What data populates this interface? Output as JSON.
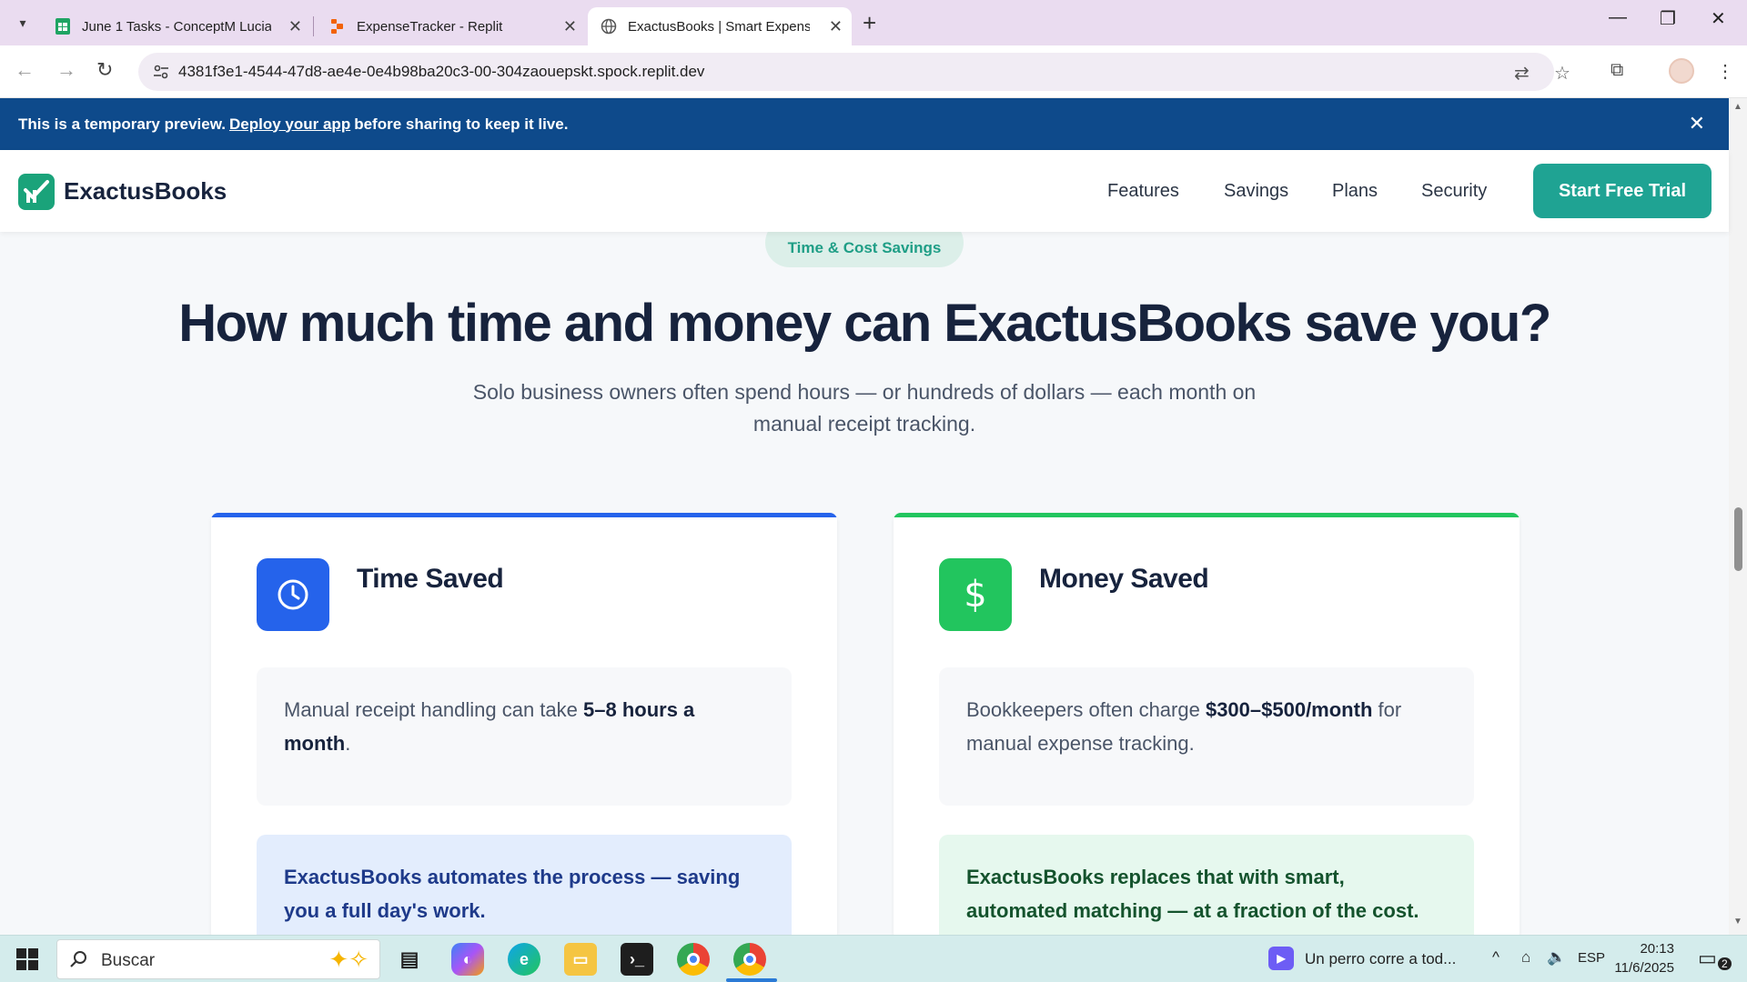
{
  "browser": {
    "tabs": [
      {
        "title": "June 1 Tasks - ConceptM Lucia",
        "favicon": "sheets-icon"
      },
      {
        "title": "ExpenseTracker - Replit",
        "favicon": "replit-icon"
      },
      {
        "title": "ExactusBooks | Smart Expense T",
        "favicon": "globe-icon",
        "active": true
      }
    ],
    "url": "4381f3e1-4544-47d8-ae4e-0e4b98ba20c3-00-304zaouepskt.spock.replit.dev"
  },
  "banner": {
    "prefix": "This is a temporary preview.",
    "link": "Deploy your app",
    "suffix": "before sharing to keep it live."
  },
  "site": {
    "brand": "ExactusBooks",
    "nav": [
      "Features",
      "Savings",
      "Plans",
      "Security"
    ],
    "cta": "Start Free Trial",
    "pill": "Time & Cost Savings",
    "headline": "How much time and money can ExactusBooks save you?",
    "subhead": "Solo business owners often spend hours — or hundreds of dollars — each month on manual receipt tracking.",
    "cards": [
      {
        "title": "Time Saved",
        "info_pre": "Manual receipt handling can take ",
        "info_bold": "5–8 hours a month",
        "info_post": ".",
        "highlight": "ExactusBooks automates the process — saving you a full day's work.",
        "accent": "#2563eb"
      },
      {
        "title": "Money Saved",
        "info_pre": "Bookkeepers often charge ",
        "info_bold": "$300–$500/month",
        "info_post": " for manual expense tracking.",
        "highlight": "ExactusBooks replaces that with smart, automated matching — at a fraction of the cost.",
        "accent": "#22c55e"
      }
    ]
  },
  "taskbar": {
    "search_placeholder": "Buscar",
    "media": "Un perro corre a tod...",
    "lang": "ESP",
    "time": "20:13",
    "date": "11/6/2025",
    "notif_count": "2"
  }
}
